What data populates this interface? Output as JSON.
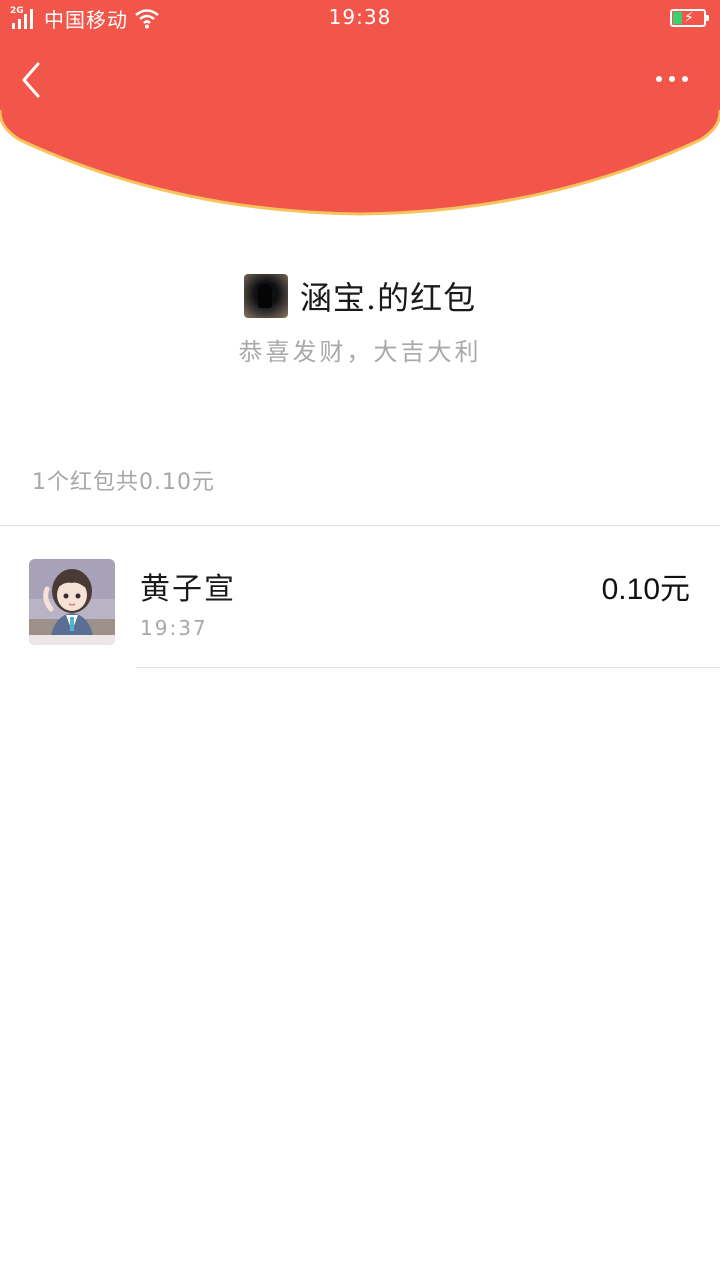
{
  "status_bar": {
    "network": "2G",
    "carrier": "中国移动",
    "time": "19:38",
    "battery_level": 0.3
  },
  "header": {
    "color": "#f2554a",
    "rim_color": "#f7c35a"
  },
  "sender": {
    "name": "涵宝.的红包",
    "wish": "恭喜发财，大吉大利"
  },
  "summary": "1个红包共0.10元",
  "receivers": [
    {
      "name": "黄子宣",
      "time": "19:37",
      "amount": "0.10元"
    }
  ]
}
